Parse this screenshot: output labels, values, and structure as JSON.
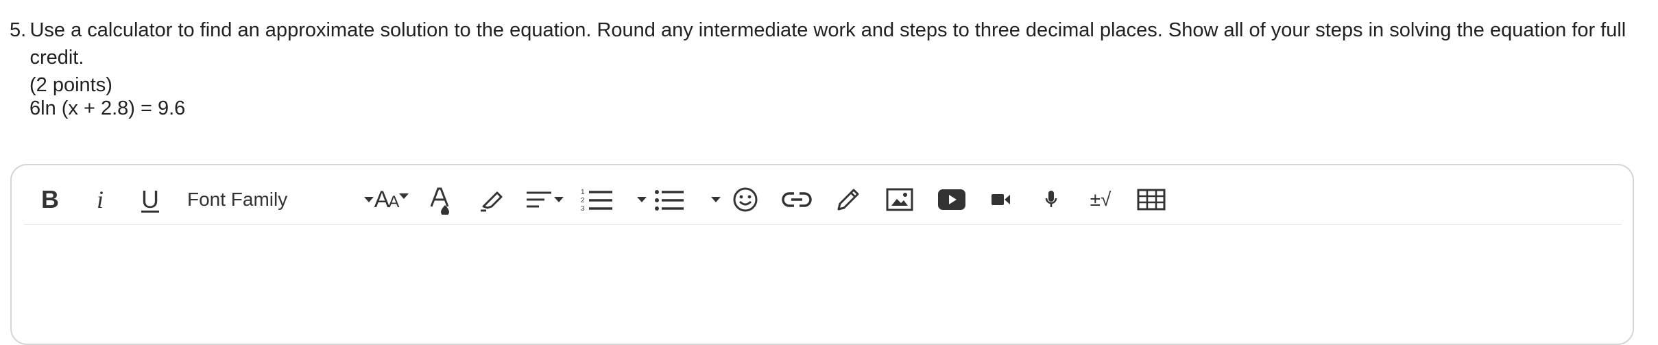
{
  "question": {
    "number": "5.",
    "text": "Use a calculator to find an approximate solution to the equation. Round any intermediate work and steps to three decimal places. Show all of your steps in solving the equation for full credit.",
    "points": "(2 points)",
    "equation": "6ln (x + 2.8) = 9.6"
  },
  "toolbar": {
    "bold_label": "B",
    "italic_label": "i",
    "underline_label": "U",
    "font_family_label": "Font Family",
    "font_size_big": "A",
    "font_size_small": "A",
    "math_label": "±√"
  },
  "icons": [
    "bold-icon",
    "italic-icon",
    "underline-icon",
    "font-family-dropdown",
    "font-size-icon",
    "font-color-icon",
    "highlighter-icon",
    "align-icon",
    "numbered-list-icon",
    "bullet-list-icon",
    "emoji-icon",
    "link-icon",
    "draw-icon",
    "image-icon",
    "video-play-icon",
    "video-camera-icon",
    "microphone-icon",
    "math-icon",
    "table-icon"
  ],
  "editor": {
    "value": ""
  }
}
